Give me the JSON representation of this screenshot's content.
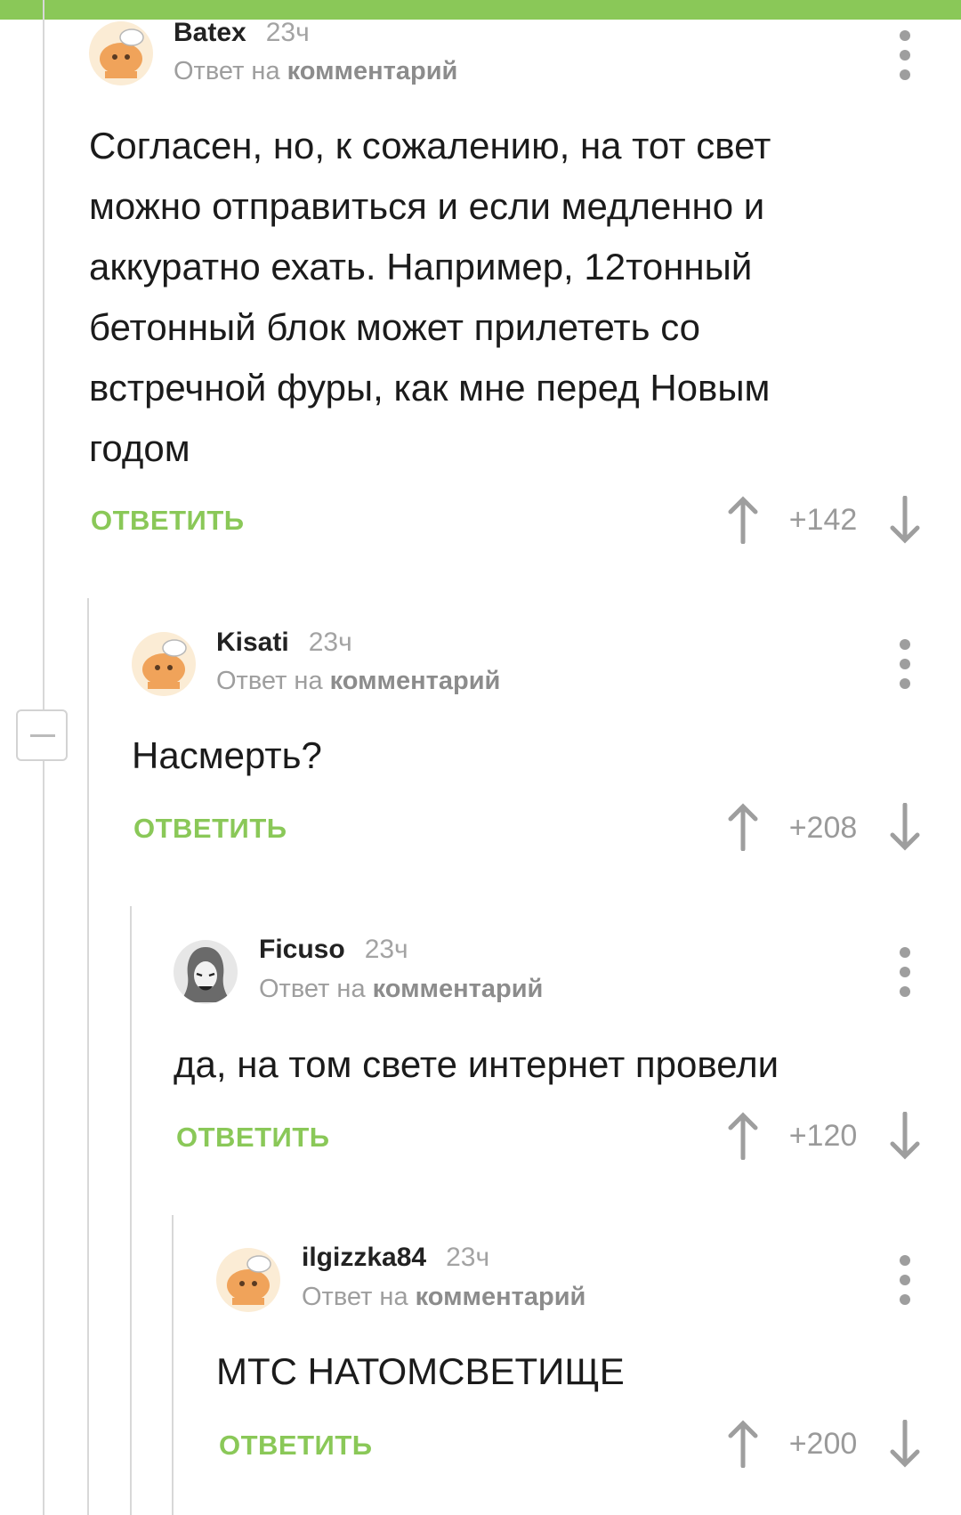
{
  "reply_prefix": "Ответ на",
  "reply_target": "комментарий",
  "reply_label": "ОТВЕТИТЬ",
  "comments": [
    {
      "author": "Batex",
      "time": "23ч",
      "text": "Согласен, но, к сожалению, на тот свет можно отправиться и если медленно и аккуратно ехать. Например, 12тонный бетонный блок может прилететь со встречной фуры, как мне перед Новым годом",
      "score": "+142",
      "avatar": "cat-avatar"
    },
    {
      "author": "Kisati",
      "time": "23ч",
      "text": "Насмерть?",
      "score": "+208",
      "avatar": "cat-avatar"
    },
    {
      "author": "Ficuso",
      "time": "23ч",
      "text": "да, на том свете интернет провели",
      "score": "+120",
      "avatar": "hooded-figure-avatar"
    },
    {
      "author": "ilgizzka84",
      "time": "23ч",
      "text": "МТС НАТОМСВЕТИЩЕ",
      "score": "+200",
      "avatar": "cat-avatar"
    }
  ],
  "colors": {
    "accent": "#8ac858",
    "muted": "#9e9e9e",
    "thread": "#d8d8d8"
  }
}
